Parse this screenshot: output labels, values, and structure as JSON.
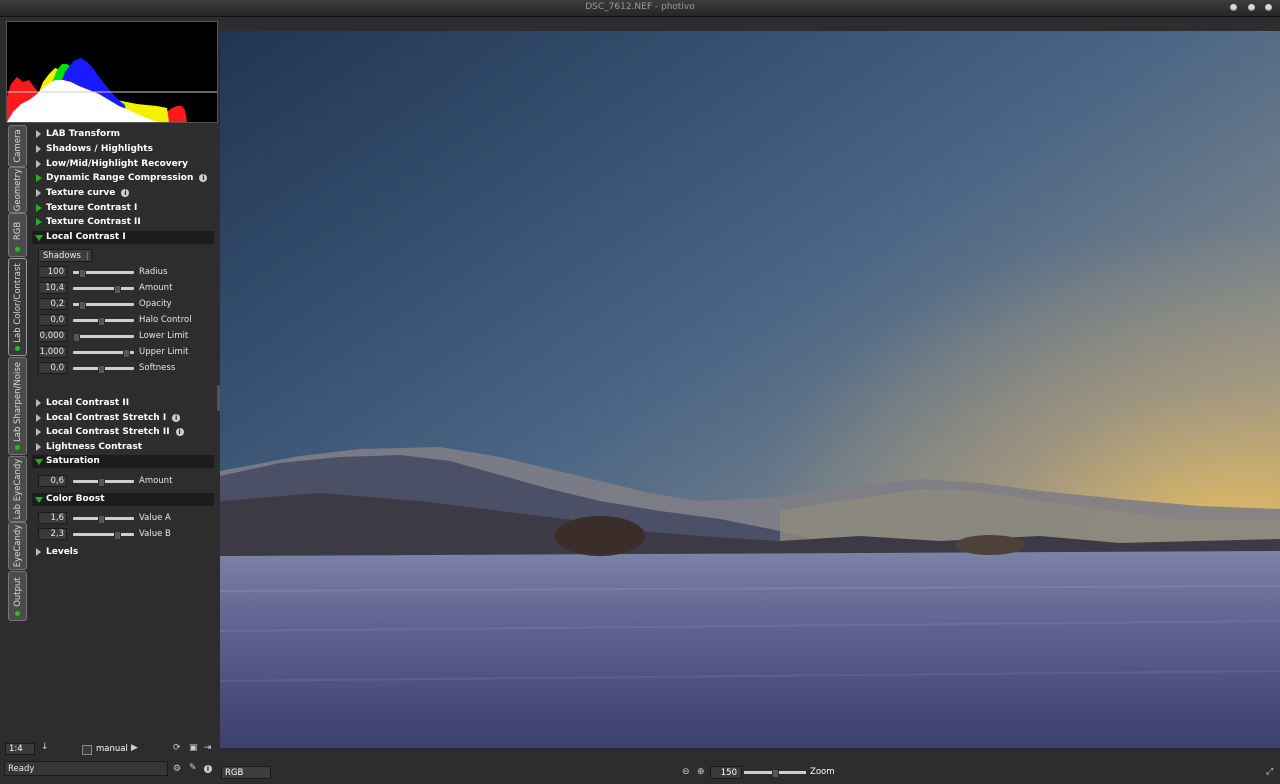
{
  "window": {
    "title": "DSC_7612.NEF - photivo"
  },
  "tabs": [
    {
      "label": "Camera",
      "dot": false
    },
    {
      "label": "Geometry",
      "dot": false
    },
    {
      "label": "RGB",
      "dot": true
    },
    {
      "label": "Lab Color/Contrast",
      "dot": true,
      "active": true
    },
    {
      "label": "Lab Sharpen/Noise",
      "dot": true
    },
    {
      "label": "Lab EyeCandy",
      "dot": false
    },
    {
      "label": "EyeCandy",
      "dot": false
    },
    {
      "label": "Output",
      "dot": true
    }
  ],
  "sections": [
    {
      "label": "LAB Transform",
      "state": "collapsed"
    },
    {
      "label": "Shadows / Highlights",
      "state": "collapsed"
    },
    {
      "label": "Low/Mid/Highlight Recovery",
      "state": "collapsed"
    },
    {
      "label": "Dynamic Range Compression",
      "state": "active",
      "info": true
    },
    {
      "label": "Texture curve",
      "state": "collapsed",
      "info": true
    },
    {
      "label": "Texture Contrast I",
      "state": "active"
    },
    {
      "label": "Texture Contrast II",
      "state": "active"
    },
    {
      "label": "Local Contrast I",
      "state": "open"
    },
    {
      "label": "Local Contrast II",
      "state": "collapsed"
    },
    {
      "label": "Local Contrast Stretch I",
      "state": "collapsed",
      "info": true
    },
    {
      "label": "Local Contrast Stretch II",
      "state": "collapsed",
      "info": true
    },
    {
      "label": "Lightness Contrast",
      "state": "collapsed"
    },
    {
      "label": "Saturation",
      "state": "open"
    },
    {
      "label": "Color Boost",
      "state": "open"
    },
    {
      "label": "Levels",
      "state": "collapsed"
    }
  ],
  "local_contrast_1": {
    "mode": "Shadows",
    "sliders": [
      {
        "value": "100",
        "label": "Radius",
        "pos": 0.1
      },
      {
        "value": "10,4",
        "label": "Amount",
        "pos": 0.75
      },
      {
        "value": "0,2",
        "label": "Opacity",
        "pos": 0.1
      },
      {
        "value": "0,0",
        "label": "Halo Control",
        "pos": 0.45
      },
      {
        "value": "0,000",
        "label": "Lower Limit",
        "pos": 0.0
      },
      {
        "value": "1,000",
        "label": "Upper Limit",
        "pos": 0.9
      },
      {
        "value": "0,0",
        "label": "Softness",
        "pos": 0.45
      }
    ]
  },
  "saturation": {
    "sliders": [
      {
        "value": "0,6",
        "label": "Amount",
        "pos": 0.45
      }
    ]
  },
  "color_boost": {
    "sliders": [
      {
        "value": "1,6",
        "label": "Value A",
        "pos": 0.45
      },
      {
        "value": "2,3",
        "label": "Value B",
        "pos": 0.75
      }
    ]
  },
  "bottom": {
    "scale": "1:4",
    "manual_label": "manual",
    "status": "Ready",
    "colorspace": "RGB",
    "zoom_value": "150",
    "zoom_label": "Zoom"
  },
  "icons": {
    "info": "info-icon",
    "down_arrow": "down-arrow-icon",
    "play": "play-icon",
    "zoom_out": "zoom-out-icon",
    "zoom_in": "zoom-in-icon"
  }
}
